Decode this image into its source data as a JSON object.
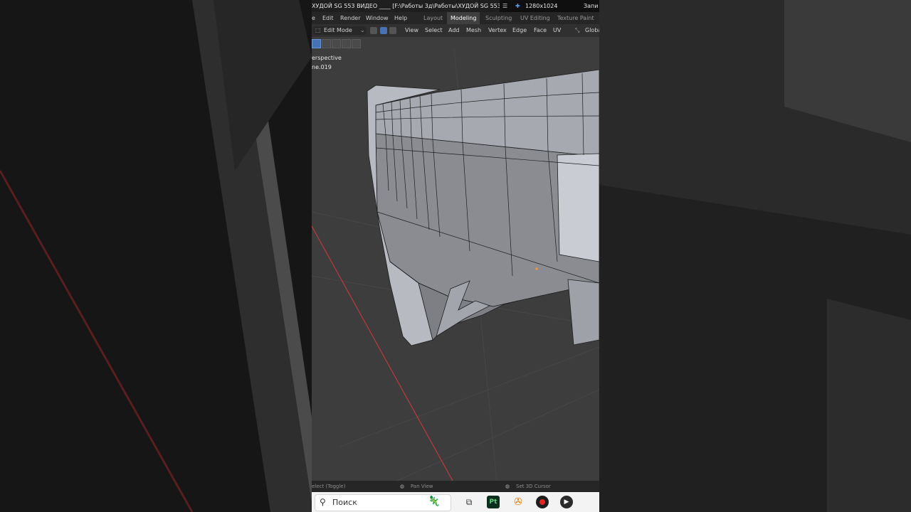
{
  "window": {
    "title": "ХУДОЙ SG 553 ВИДЕО ____ [F:\\Работы 3д\\Работы\\ХУДОЙ SG 553 ВИ",
    "resolution": "1280x1024",
    "record_label": "Запи"
  },
  "menu": {
    "items": [
      "e",
      "Edit",
      "Render",
      "Window",
      "Help"
    ],
    "workspaces": [
      "Layout",
      "Modeling",
      "Sculpting",
      "UV Editing",
      "Texture Paint"
    ],
    "active_workspace": "Modeling"
  },
  "header": {
    "mode": "Edit Mode",
    "menus": [
      "View",
      "Select",
      "Add",
      "Mesh",
      "Vertex",
      "Edge",
      "Face",
      "UV"
    ],
    "transform_orientation": "Globa"
  },
  "viewport": {
    "view_label": "erspective",
    "object_label": "ne.019"
  },
  "statusbar": {
    "left": "elect (Toggle)",
    "middle": "Pan View",
    "right": "Set 3D Cursor"
  },
  "taskbar": {
    "search_placeholder": "Поиск",
    "app_labels": [
      "Pt"
    ]
  },
  "colors": {
    "accent": "#4772b3",
    "viewport_bg": "#3d3d3d",
    "x_axis": "#c0393b",
    "mesh_face": "#8f9198",
    "mesh_edge": "#1e1e1e"
  }
}
